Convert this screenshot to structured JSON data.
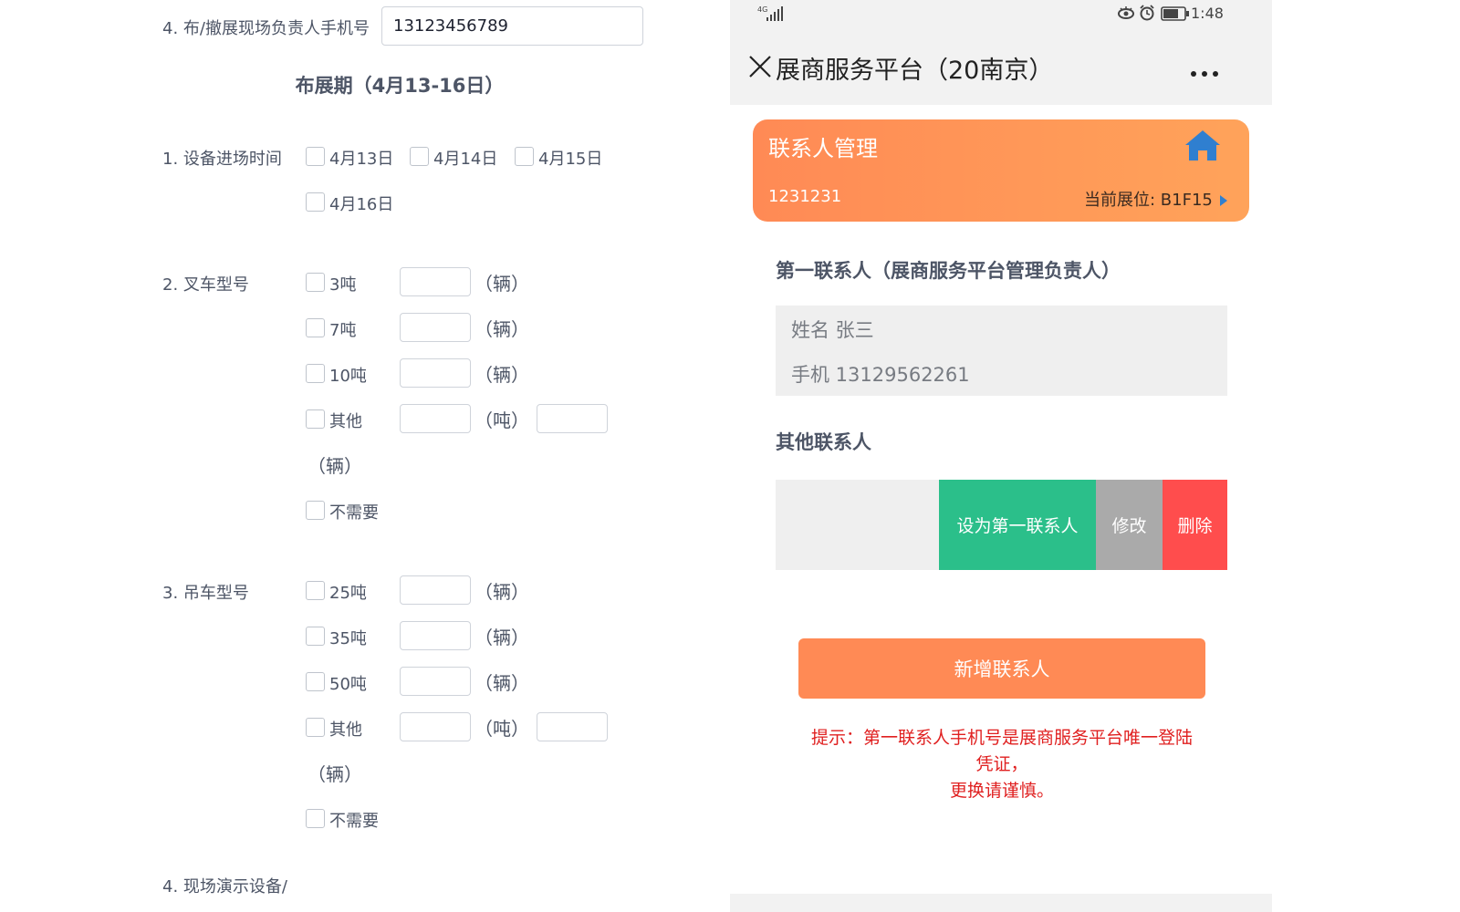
{
  "form": {
    "q4_label": "4. 布/撤展现场负责人手机号",
    "q4_value": "13123456789",
    "section_title": "布展期（4月13-16日）",
    "q1": {
      "label": "1. 设备进场时间",
      "options": [
        "4月13日",
        "4月14日",
        "4月15日",
        "4月16日"
      ]
    },
    "q2": {
      "label": "2. 叉车型号",
      "options": [
        "3吨",
        "7吨",
        "10吨",
        "其他",
        "不需要"
      ],
      "unit_vehicle": "（辆）",
      "unit_ton": "（吨）",
      "wrap_unit": "（辆）"
    },
    "q3": {
      "label": "3. 吊车型号",
      "options": [
        "25吨",
        "35吨",
        "50吨",
        "其他",
        "不需要"
      ],
      "unit_vehicle": "（辆）",
      "unit_ton": "（吨）",
      "wrap_unit": "（辆）"
    },
    "q_next_label": "4. 现场演示设备/"
  },
  "phone": {
    "status": {
      "network": "4G",
      "time": "1:48"
    },
    "nav": {
      "title": "展商服务平台（20南京）"
    },
    "banner": {
      "title": "联系人管理",
      "account": "1231231",
      "booth": "当前展位: B1F15"
    },
    "first_contact": {
      "heading": "第一联系人（展商服务平台管理负责人）",
      "name_line": "姓名 张三",
      "phone_line": "手机 13129562261"
    },
    "other_contacts": {
      "heading": "其他联系人",
      "actions": {
        "set_primary": "设为第一联系人",
        "edit": "修改",
        "delete": "删除"
      }
    },
    "add_button": "新增联系人",
    "tip_lines": [
      "提示：第一联系人手机号是展商服务平台唯一登陆",
      "凭证，",
      "更换请谨慎。"
    ],
    "colors": {
      "accent": "#ff8a55",
      "primary_action": "#2bbf8a",
      "edit_action": "#aaaaaa",
      "delete_action": "#ff4d4d",
      "tip": "#e02020"
    }
  }
}
